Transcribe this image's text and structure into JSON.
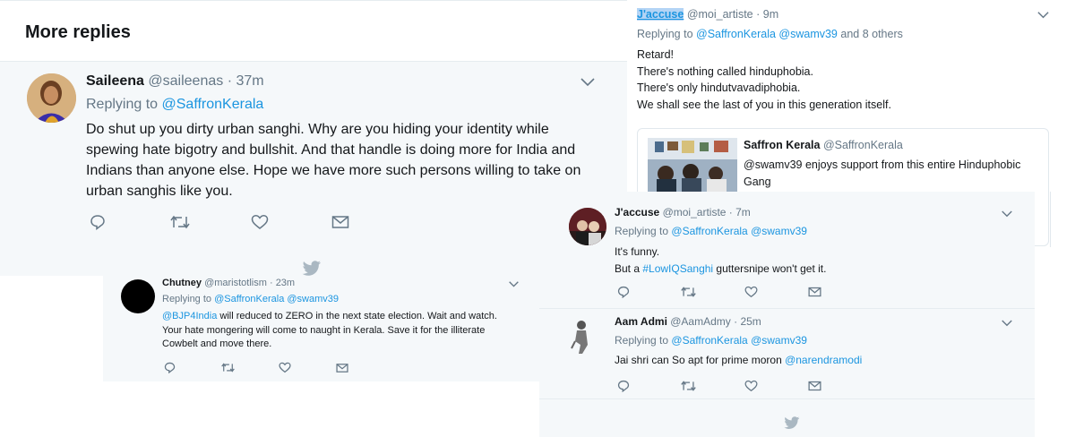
{
  "more_replies": {
    "title": "More replies"
  },
  "saileena": {
    "name": "Saileena",
    "handle": "@saileenas",
    "time": "· 37m",
    "replying_prefix": "Replying to",
    "replying_to": "@SaffronKerala",
    "text_lines": [
      "Do shut up you dirty urban sanghi. Why are you hiding your identity while",
      "spewing hate bigotry and bullshit. And that handle is doing more for India and",
      "Indians than anyone else. Hope we have more such persons willing to take on",
      "urban sanghis like you."
    ]
  },
  "chutney": {
    "name": "Chutney",
    "handle": "@maristotlism",
    "time": "· 23m",
    "replying_prefix": "Replying to",
    "replying_to": "@SaffronKerala @swamv39",
    "mention": "@BJP4India",
    "text_first_rest": " will reduced to ZERO in the next state election. Wait and watch.",
    "text_lines": [
      "Your hate mongering will come to naught in Kerala. Save it for the illiterate",
      "Cowbelt and move there."
    ]
  },
  "jaccuse_top": {
    "name": "J'accuse",
    "handle": "@moi_artiste",
    "time": "· 9m",
    "replying_prefix": "Replying to",
    "replying_to": "@SaffronKerala @swamv39",
    "replying_suffix": "and 8 others",
    "text_lines": [
      "Retard!",
      "There's nothing called hinduphobia.",
      "There's only hindutvavadiphobia.",
      "We shall see the last of you in this generation itself."
    ],
    "quote": {
      "name": "Saffron Kerala",
      "handle": "@SaffronKerala",
      "text_lines": [
        "@swamv39 enjoys support from this entire Hinduphobic",
        "Gang"
      ]
    }
  },
  "jaccuse_reply": {
    "name": "J'accuse",
    "handle": "@moi_artiste",
    "time": "· 7m",
    "replying_prefix": "Replying to",
    "replying_to": "@SaffronKerala @swamv39",
    "text_line1": "It's funny.",
    "text_line2_prefix": "But a ",
    "hashtag": "#LowIQSanghi",
    "text_line2_suffix": " guttersnipe won't get it."
  },
  "aam_admi": {
    "name": "Aam Admi",
    "handle": "@AamAdmy",
    "time": "· 25m",
    "replying_prefix": "Replying to",
    "replying_to": "@SaffronKerala @swamv39",
    "text_prefix": "Jai shri can So apt for prime moron ",
    "mention": "@narendramodi"
  },
  "colors": {
    "link": "#1b95e0",
    "secondary": "#657786",
    "panel_bg": "#f5f8fa",
    "border": "#e6ecf0",
    "bird": "#aab8c2"
  },
  "icons": [
    "reply-icon",
    "retweet-icon",
    "like-icon",
    "message-icon",
    "chevron-down-icon",
    "twitter-bird-icon"
  ]
}
